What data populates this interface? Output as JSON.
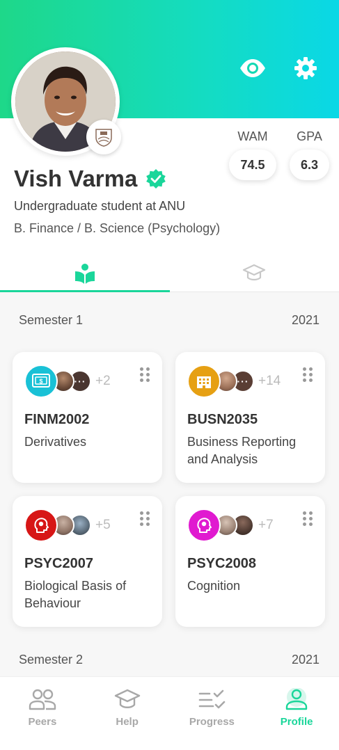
{
  "colors": {
    "accent": "#1ad69a",
    "header_start": "#1ed889",
    "header_end": "#0ad8e6"
  },
  "header": {
    "icons": [
      "eye-icon",
      "gear-icon"
    ]
  },
  "profile": {
    "name": "Vish Varma",
    "verified": true,
    "subtitle": "Undergraduate student at ANU",
    "degree": "B. Finance / B. Science (Psychology)"
  },
  "stats": {
    "wam": {
      "label": "WAM",
      "value": "74.5"
    },
    "gpa": {
      "label": "GPA",
      "value": "6.3"
    }
  },
  "tabs": [
    {
      "icon": "book-reader-icon",
      "active": true
    },
    {
      "icon": "graduation-cap-icon",
      "active": false
    }
  ],
  "semesters": [
    {
      "label": "Semester 1",
      "year": "2021",
      "courses": [
        {
          "code": "FINM2002",
          "title": "Derivatives",
          "peer_count": "+2",
          "icon": "finance-icon",
          "color": "#19c1d6"
        },
        {
          "code": "BUSN2035",
          "title": "Business Reporting and Analysis",
          "peer_count": "+14",
          "icon": "building-icon",
          "color": "#e6a013"
        },
        {
          "code": "PSYC2007",
          "title": "Biological Basis of Behaviour",
          "peer_count": "+5",
          "icon": "brain-head-icon",
          "color": "#d71616"
        },
        {
          "code": "PSYC2008",
          "title": "Cognition",
          "peer_count": "+7",
          "icon": "brain-head-icon",
          "color": "#e01ad0"
        }
      ]
    },
    {
      "label": "Semester 2",
      "year": "2021",
      "courses": []
    }
  ],
  "bottom_nav": [
    {
      "label": "Peers",
      "icon": "peers-icon",
      "active": false
    },
    {
      "label": "Help",
      "icon": "help-cap-icon",
      "active": false
    },
    {
      "label": "Progress",
      "icon": "progress-icon",
      "active": false
    },
    {
      "label": "Profile",
      "icon": "profile-icon",
      "active": true
    }
  ]
}
